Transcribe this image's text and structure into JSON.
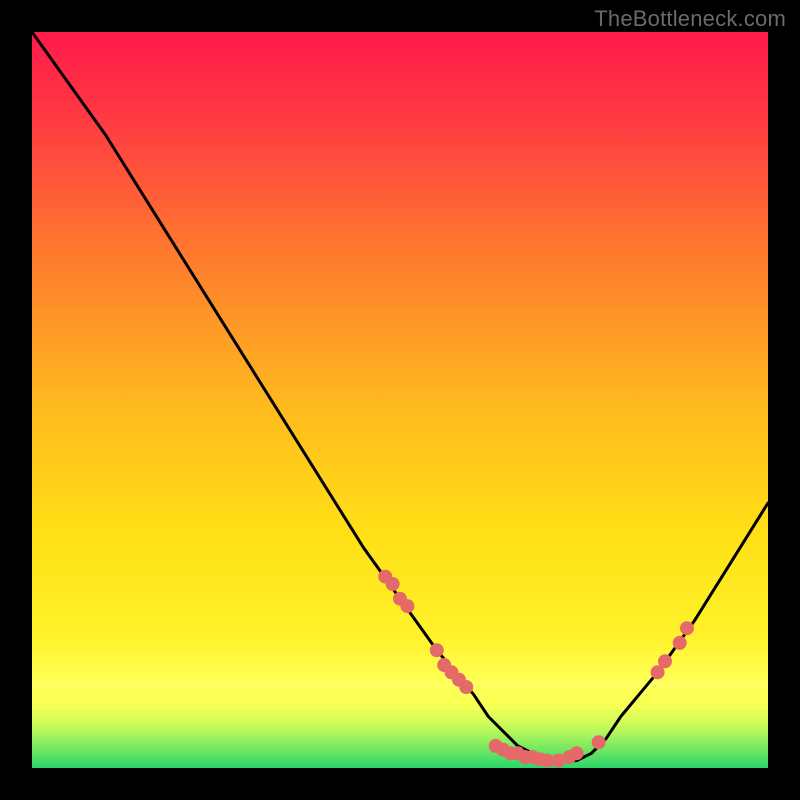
{
  "attribution": "TheBottleneck.com",
  "colors": {
    "background": "#000000",
    "attribution_text": "#6a6a6a",
    "gradient_top": "#ff1a4b",
    "gradient_mid_warm": "#ffd400",
    "gradient_band_yellow": "#ffff55",
    "gradient_bottom": "#2bd66a",
    "curve": "#000000",
    "marker": "#e46a6a"
  },
  "chart_data": {
    "type": "line",
    "title": "",
    "xlabel": "",
    "ylabel": "",
    "xlim": [
      0,
      100
    ],
    "ylim": [
      0,
      100
    ],
    "series": [
      {
        "name": "bottleneck-curve",
        "x": [
          0,
          5,
          10,
          15,
          20,
          25,
          30,
          35,
          40,
          45,
          50,
          55,
          60,
          62,
          64,
          66,
          68,
          70,
          72,
          74,
          76,
          78,
          80,
          85,
          90,
          95,
          100
        ],
        "y": [
          100,
          93,
          86,
          78,
          70,
          62,
          54,
          46,
          38,
          30,
          23,
          16,
          10,
          7,
          5,
          3,
          2,
          1,
          1,
          1,
          2,
          4,
          7,
          13,
          20,
          28,
          36
        ]
      }
    ],
    "markers": [
      {
        "x": 48,
        "y": 26
      },
      {
        "x": 49,
        "y": 25
      },
      {
        "x": 50,
        "y": 23
      },
      {
        "x": 51,
        "y": 22
      },
      {
        "x": 55,
        "y": 16
      },
      {
        "x": 56,
        "y": 14
      },
      {
        "x": 57,
        "y": 13
      },
      {
        "x": 58,
        "y": 12
      },
      {
        "x": 59,
        "y": 11
      },
      {
        "x": 63,
        "y": 3
      },
      {
        "x": 64,
        "y": 2.5
      },
      {
        "x": 65,
        "y": 2
      },
      {
        "x": 66,
        "y": 2
      },
      {
        "x": 67,
        "y": 1.5
      },
      {
        "x": 68,
        "y": 1.5
      },
      {
        "x": 69,
        "y": 1.2
      },
      {
        "x": 70,
        "y": 1
      },
      {
        "x": 71.5,
        "y": 1
      },
      {
        "x": 73,
        "y": 1.5
      },
      {
        "x": 74,
        "y": 2
      },
      {
        "x": 77,
        "y": 3.5
      },
      {
        "x": 85,
        "y": 13
      },
      {
        "x": 86,
        "y": 14.5
      },
      {
        "x": 88,
        "y": 17
      },
      {
        "x": 89,
        "y": 19
      }
    ],
    "grid": false,
    "legend": false
  }
}
